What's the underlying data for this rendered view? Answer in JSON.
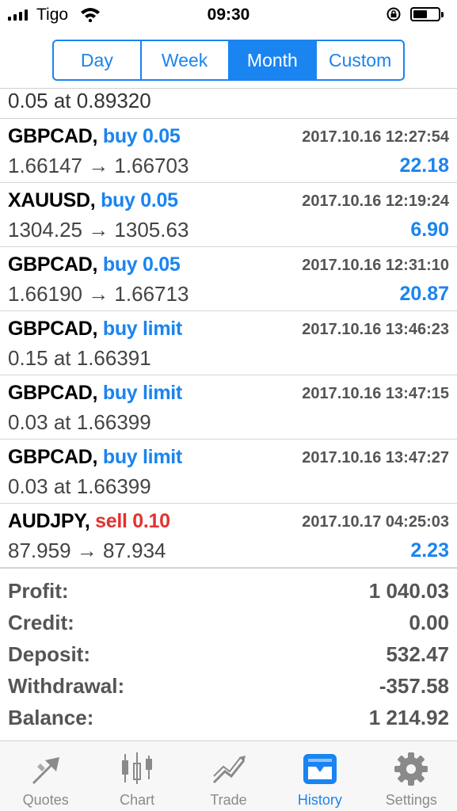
{
  "status": {
    "carrier": "Tigo",
    "time": "09:30"
  },
  "segments": [
    {
      "label": "Day",
      "active": false
    },
    {
      "label": "Week",
      "active": false
    },
    {
      "label": "Month",
      "active": true
    },
    {
      "label": "Custom",
      "active": false
    }
  ],
  "partial_row": {
    "detail": "0.05 at 0.89320"
  },
  "rows": [
    {
      "symbol": "GBPCAD,",
      "action": "buy 0.05",
      "side": "buy",
      "date": "2017.10.16 12:27:54",
      "detail": "1.66147 → 1.66703",
      "profit": "22.18"
    },
    {
      "symbol": "XAUUSD,",
      "action": "buy 0.05",
      "side": "buy",
      "date": "2017.10.16 12:19:24",
      "detail": "1304.25 → 1305.63",
      "profit": "6.90"
    },
    {
      "symbol": "GBPCAD,",
      "action": "buy 0.05",
      "side": "buy",
      "date": "2017.10.16 12:31:10",
      "detail": "1.66190 → 1.66713",
      "profit": "20.87"
    },
    {
      "symbol": "GBPCAD,",
      "action": "buy limit",
      "side": "buy",
      "date": "2017.10.16 13:46:23",
      "detail": "0.15 at 1.66391",
      "profit": ""
    },
    {
      "symbol": "GBPCAD,",
      "action": "buy limit",
      "side": "buy",
      "date": "2017.10.16 13:47:15",
      "detail": "0.03 at 1.66399",
      "profit": ""
    },
    {
      "symbol": "GBPCAD,",
      "action": "buy limit",
      "side": "buy",
      "date": "2017.10.16 13:47:27",
      "detail": "0.03 at 1.66399",
      "profit": ""
    },
    {
      "symbol": "AUDJPY,",
      "action": "sell 0.10",
      "side": "sell",
      "date": "2017.10.17 04:25:03",
      "detail": "87.959 → 87.934",
      "profit": "2.23"
    }
  ],
  "summary": [
    {
      "label": "Profit:",
      "value": "1 040.03"
    },
    {
      "label": "Credit:",
      "value": "0.00"
    },
    {
      "label": "Deposit:",
      "value": "532.47"
    },
    {
      "label": "Withdrawal:",
      "value": "-357.58"
    },
    {
      "label": "Balance:",
      "value": "1 214.92"
    }
  ],
  "tabs": [
    {
      "label": "Quotes",
      "icon": "quotes-icon",
      "active": false
    },
    {
      "label": "Chart",
      "icon": "chart-icon",
      "active": false
    },
    {
      "label": "Trade",
      "icon": "trade-icon",
      "active": false
    },
    {
      "label": "History",
      "icon": "history-icon",
      "active": true
    },
    {
      "label": "Settings",
      "icon": "settings-icon",
      "active": false
    }
  ],
  "colors": {
    "accent": "#1a84f0",
    "sell": "#e0332f",
    "muted": "#555555"
  }
}
